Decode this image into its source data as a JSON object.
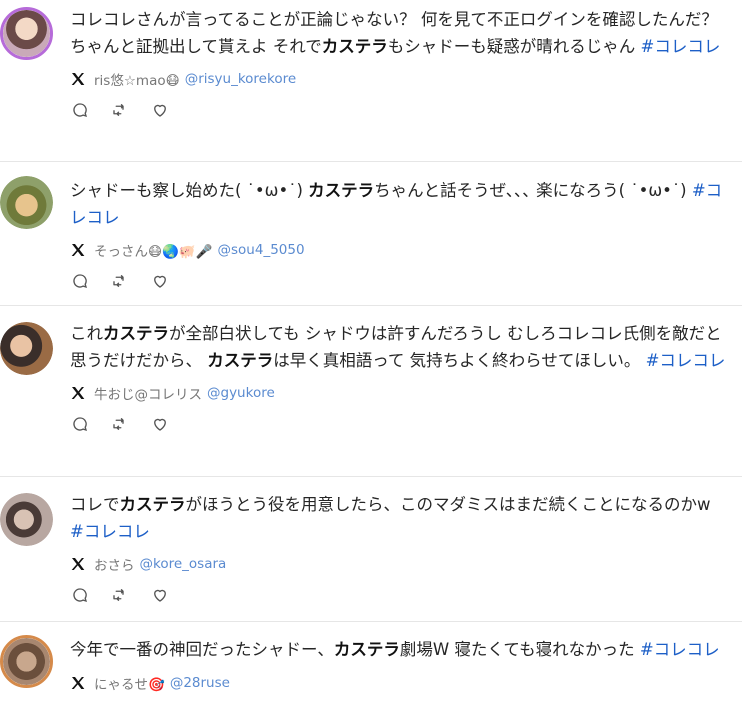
{
  "posts": [
    {
      "text_parts": [
        {
          "t": "コレコレさんが言ってることが正論じゃない？ 何を見て不正ログインを確認したんだ？ ちゃんと証拠出して貰えよ それで",
          "b": false
        },
        {
          "t": "カステラ",
          "b": true
        },
        {
          "t": "もシャドーも疑惑が晴れるじゃん ",
          "b": false
        }
      ],
      "hashtag": "#コレコレ",
      "name": "ris悠☆mao😷",
      "handle": "@risyu_korekore"
    },
    {
      "text_parts": [
        {
          "t": "シャドーも察し始めた( ˙•ω•˙) ",
          "b": false
        },
        {
          "t": "カステラ",
          "b": true
        },
        {
          "t": "ちゃんと話そうぜ､､､ 楽になろう( ˙•ω•˙) ",
          "b": false
        }
      ],
      "hashtag": "#コレコレ",
      "name": "そっさん😷🌏🐖🎤",
      "handle": "@sou4_5050"
    },
    {
      "text_parts": [
        {
          "t": "これ",
          "b": false
        },
        {
          "t": "カステラ",
          "b": true
        },
        {
          "t": "が全部白状しても シャドウは許すんだろうし むしろコレコレ氏側を敵だと 思うだけだから、 ",
          "b": false
        },
        {
          "t": "カステラ",
          "b": true
        },
        {
          "t": "は早く真相語って 気持ちよく終わらせてほしい。 ",
          "b": false
        }
      ],
      "hashtag": "#コレコレ",
      "name": "牛おじ@コレリス",
      "handle": "@gyukore"
    },
    {
      "text_parts": [
        {
          "t": "コレで",
          "b": false
        },
        {
          "t": "カステラ",
          "b": true
        },
        {
          "t": "がほうとう役を用意したら、このマダミスはまだ続くことになるのかw ",
          "b": false
        }
      ],
      "hashtag": "#コレコレ",
      "name": "おさら",
      "handle": "@kore_osara"
    },
    {
      "text_parts": [
        {
          "t": "今年で一番の神回だったシャドー、",
          "b": false
        },
        {
          "t": "カステラ",
          "b": true
        },
        {
          "t": "劇場W 寝たくても寝れなかった ",
          "b": false
        }
      ],
      "hashtag": "#コレコレ",
      "name": "にゃるせ🎯",
      "handle": "@28ruse"
    }
  ],
  "icons": {
    "platform": "x-logo-icon",
    "reply": "reply-icon",
    "repost": "repost-icon",
    "like": "like-icon"
  },
  "colors": {
    "hashtag": "#1d5fc7",
    "handle": "#5b8bd0",
    "avatar_ring": "#b66bd9"
  }
}
